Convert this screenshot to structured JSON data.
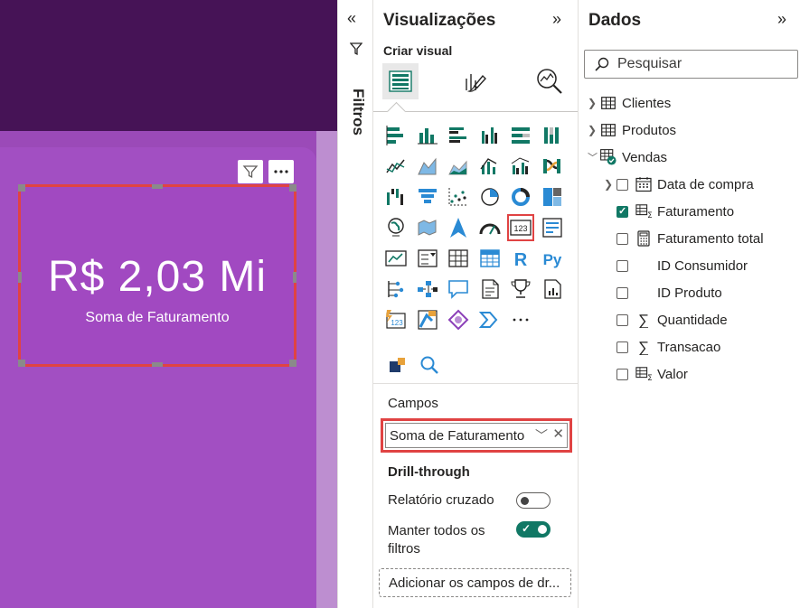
{
  "card": {
    "value": "R$ 2,03 Mi",
    "label": "Soma de Faturamento"
  },
  "filters": {
    "label": "Filtros"
  },
  "visualizations": {
    "title": "Visualizações",
    "subtitle": "Criar visual",
    "more_label": "...",
    "fields_label": "Campos",
    "field_value": "Soma de Faturamento",
    "drill_title": "Drill-through",
    "cross_report_label": "Relatório cruzado",
    "keep_filters_label": "Manter todos os filtros",
    "add_drill_label": "Adicionar os campos de dr...",
    "icons": [
      "stacked-bar-icon",
      "stacked-column-icon",
      "clustered-bar-icon",
      "clustered-column-icon",
      "100-bar-icon",
      "100-column-icon",
      "line-chart-icon",
      "area-chart-icon",
      "stacked-area-icon",
      "line-column-icon",
      "line-clustered-icon",
      "ribbon-chart-icon",
      "waterfall-icon",
      "funnel-icon",
      "scatter-icon",
      "pie-chart-icon",
      "donut-chart-icon",
      "treemap-icon",
      "map-icon",
      "filled-map-icon",
      "azure-map-icon",
      "gauge-icon",
      "card-icon",
      "multi-row-card-icon",
      "kpi-icon",
      "slicer-icon",
      "table-icon",
      "matrix-icon",
      "r-visual-icon",
      "python-visual-icon",
      "key-influencers-icon",
      "decomposition-tree-icon",
      "qa-icon",
      "smart-narrative-icon",
      "goals-icon",
      "paginated-report-icon",
      "power-apps-icon",
      "power-automate-icon",
      "power-bi-icon",
      "arrow-chevrons-icon",
      "more-visuals-icon"
    ]
  },
  "data_pane": {
    "title": "Dados",
    "search_placeholder": "Pesquisar",
    "tables": [
      {
        "name": "Clientes"
      },
      {
        "name": "Produtos"
      },
      {
        "name": "Vendas"
      }
    ],
    "fields": [
      {
        "name": "Data de compra",
        "checked": false,
        "icon": "calendar-icon"
      },
      {
        "name": "Faturamento",
        "checked": true,
        "icon": "sigma-table-icon"
      },
      {
        "name": "Faturamento total",
        "checked": false,
        "icon": "calculator-icon"
      },
      {
        "name": "ID Consumidor",
        "checked": false,
        "icon": ""
      },
      {
        "name": "ID Produto",
        "checked": false,
        "icon": ""
      },
      {
        "name": "Quantidade",
        "checked": false,
        "icon": "sigma-icon"
      },
      {
        "name": "Transacao",
        "checked": false,
        "icon": "sigma-icon"
      },
      {
        "name": "Valor",
        "checked": false,
        "icon": "sigma-table-icon"
      }
    ]
  },
  "colors": {
    "canvas_dark": "#461356",
    "canvas_purple": "#9b4ab8",
    "card_bg": "#a149c1",
    "highlight_red": "#e04343",
    "accent_teal": "#117865"
  }
}
